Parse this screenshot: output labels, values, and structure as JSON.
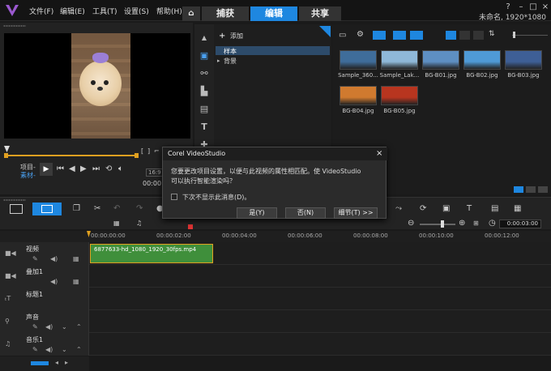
{
  "menu": [
    "文件(F)",
    "编辑(E)",
    "工具(T)",
    "设置(S)",
    "帮助(H)"
  ],
  "tabs": {
    "capture": "捕获",
    "edit": "编辑",
    "share": "共享"
  },
  "project_info": "未命名, 1920*1080",
  "preview": {
    "mode_project": "项目-",
    "mode_clip": "素材-",
    "timecode": "00:00"
  },
  "library": {
    "add_label": "添加",
    "tree": [
      "样本",
      "背景"
    ],
    "thumbnails": [
      {
        "label": "Sample_360...",
        "color": "#3f6d9a"
      },
      {
        "label": "Sample_Lak...",
        "color": "#8fb8d8"
      },
      {
        "label": "BG-B01.jpg",
        "color": "#5e8fc2"
      },
      {
        "label": "BG-B02.jpg",
        "color": "#4f9ad6"
      },
      {
        "label": "BG-B03.jpg",
        "color": "#3e5f96"
      },
      {
        "label": "BG-B04.jpg",
        "color": "#d07a2f"
      },
      {
        "label": "BG-B05.jpg",
        "color": "#b8351f"
      }
    ]
  },
  "dialog": {
    "title": "Corel VideoStudio",
    "message_line1": "您要更改项目设置，以便与此视频的属性相匹配。使 VideoStudio",
    "message_line2": "可以执行智能渲染吗？",
    "checkbox_label": "下次不显示此消息(D)。",
    "yes": "是(Y)",
    "no": "否(N)",
    "details": "细节(T) >>"
  },
  "timeline": {
    "timecode": "0:00:03:00",
    "ruler": [
      "00:00:00:00",
      "00:00:02:00",
      "00:00:04:00",
      "00:00:06:00",
      "00:00:08:00",
      "00:00:10:00",
      "00:00:12:00"
    ],
    "clip_name": "6877633-hd_1080_1920_30fps.mp4",
    "tracks": [
      "视频",
      "叠加1",
      "标题1",
      "声音",
      "音乐1"
    ]
  },
  "colors": {
    "accent": "#1e87e0",
    "clip": "#3f8f3b"
  }
}
